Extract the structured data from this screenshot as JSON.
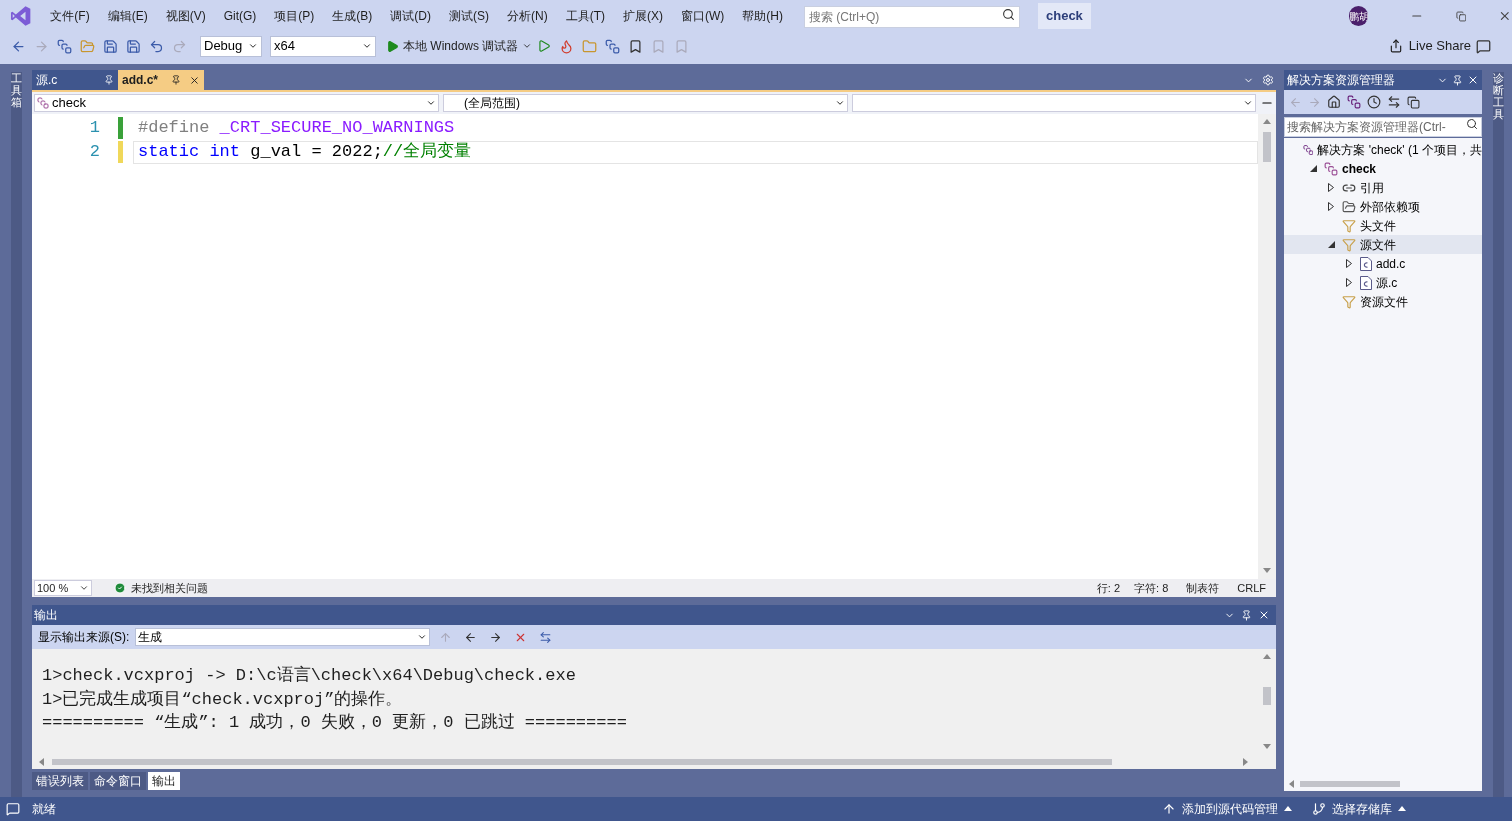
{
  "menu": [
    "文件(F)",
    "编辑(E)",
    "视图(V)",
    "Git(G)",
    "项目(P)",
    "生成(B)",
    "调试(D)",
    "测试(S)",
    "分析(N)",
    "工具(T)",
    "扩展(X)",
    "窗口(W)",
    "帮助(H)"
  ],
  "search": {
    "placeholder": "搜索 (Ctrl+Q)"
  },
  "solution_name": "check",
  "avatar_text": "鹏胡",
  "toolbar": {
    "configuration": "Debug",
    "platform": "x64",
    "run_label": "本地 Windows 调试器",
    "live_share": "Live Share"
  },
  "side_strips": {
    "left": "工具箱",
    "right": "诊断工具"
  },
  "editor": {
    "tabs": [
      {
        "label": "源.c",
        "selected": false
      },
      {
        "label": "add.c*",
        "selected": true
      }
    ],
    "nav": {
      "project": "check",
      "scope": "(全局范围)"
    },
    "lines": [
      {
        "number": "1",
        "saved": true,
        "current": false,
        "tokens": [
          {
            "kind": "preprocessor",
            "text": "#define"
          },
          {
            "kind": "macro",
            "text": " _CRT_SECURE_NO_WARNINGS"
          }
        ]
      },
      {
        "number": "2",
        "saved": false,
        "current": true,
        "tokens": [
          {
            "kind": "keyword",
            "text": "static"
          },
          {
            "kind": "keyword",
            "text": " int"
          },
          {
            "kind": "plain",
            "text": " g_val = 2022;"
          },
          {
            "kind": "comment",
            "text": "//全局变量"
          }
        ]
      }
    ],
    "status": {
      "zoom": "100 %",
      "issues": "未找到相关问题",
      "line": "行: 2",
      "column": "字符: 8",
      "indent": "制表符",
      "eol": "CRLF"
    }
  },
  "output": {
    "title": "输出",
    "source_label": "显示输出来源(S):",
    "source": "生成",
    "lines": [
      "1>check.vcxproj -> D:\\c语言\\check\\x64\\Debug\\check.exe",
      "1>已完成生成项目“check.vcxproj”的操作。",
      "========== “生成”: 1 成功，0 失败，0 更新，0 已跳过 =========="
    ]
  },
  "bottom_tabs": [
    {
      "label": "错误列表",
      "selected": false
    },
    {
      "label": "命令窗口",
      "selected": false
    },
    {
      "label": "输出",
      "selected": true
    }
  ],
  "solution_explorer": {
    "title": "解决方案资源管理器",
    "search_placeholder": "搜索解决方案资源管理器(Ctrl-",
    "tree": [
      {
        "label": "解决方案 'check' (1 个项目，共",
        "kind": "solution",
        "selected": false,
        "children": [
          {
            "label": "check",
            "kind": "project",
            "expanded": true,
            "selected": false,
            "children": [
              {
                "label": "引用",
                "kind": "references",
                "expanded": false,
                "selected": false
              },
              {
                "label": "外部依赖项",
                "kind": "external",
                "expanded": false,
                "selected": false
              },
              {
                "label": "头文件",
                "kind": "filter",
                "selected": false
              },
              {
                "label": "源文件",
                "kind": "filter",
                "expanded": true,
                "selected": true,
                "children": [
                  {
                    "label": "add.c",
                    "kind": "file",
                    "expanded": false,
                    "selected": false
                  },
                  {
                    "label": "源.c",
                    "kind": "file",
                    "expanded": false,
                    "selected": false
                  }
                ]
              },
              {
                "label": "资源文件",
                "kind": "filter",
                "selected": false
              }
            ]
          }
        ]
      }
    ]
  },
  "status_bar": {
    "ready": "就绪",
    "source_control": "添加到源代码管理",
    "repository": "选择存储库"
  }
}
